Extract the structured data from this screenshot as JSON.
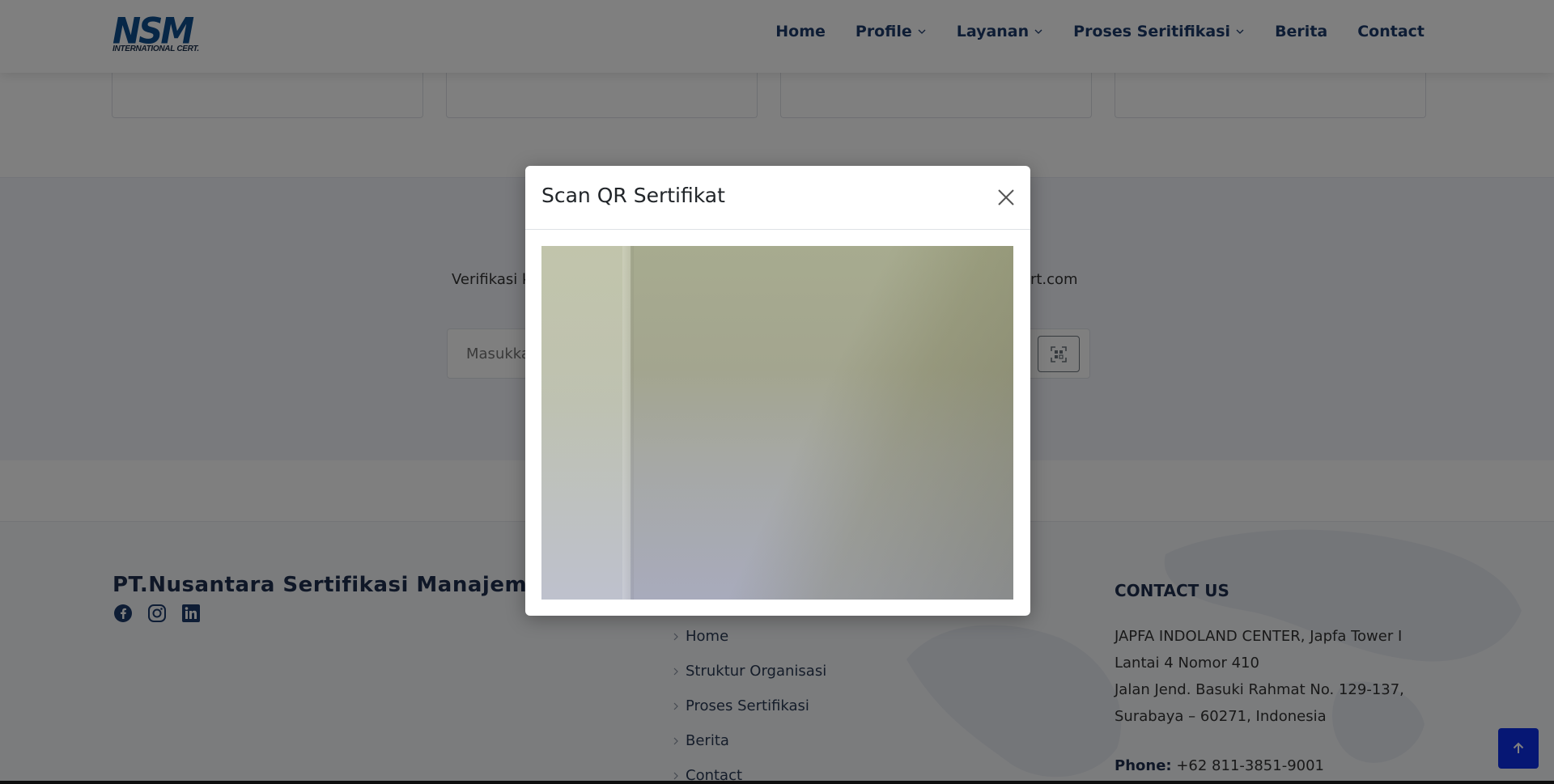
{
  "header": {
    "logo_text": "NSM",
    "logo_subtext": "INTERNATIONAL CERT.",
    "nav": [
      {
        "label": "Home",
        "dropdown": false
      },
      {
        "label": "Profile",
        "dropdown": true
      },
      {
        "label": "Layanan",
        "dropdown": true
      },
      {
        "label": "Proses Seritifikasi",
        "dropdown": true
      },
      {
        "label": "Berita",
        "dropdown": false
      },
      {
        "label": "Contact",
        "dropdown": false
      }
    ]
  },
  "verify": {
    "text_visible_start": "Verifikasi k",
    "text_visible_end": "cert.com",
    "search_placeholder_visible": "Masukka",
    "qr_button_icon": "qr-scan-icon"
  },
  "footer": {
    "company_name": "PT.Nusantara Sertifikasi Manajemen",
    "socials": [
      "facebook-icon",
      "instagram-icon",
      "linkedin-icon"
    ],
    "links": [
      "Home",
      "Struktur Organisasi",
      "Proses Sertifikasi",
      "Berita",
      "Contact"
    ],
    "contact_title": "CONTACT US",
    "address_line1": "JAPFA INDOLAND CENTER, Japfa Tower I Lantai 4 Nomor 410",
    "address_line2": "Jalan Jend. Basuki Rahmat No. 129-137, Surabaya – 60271, Indonesia",
    "phone_label": "Phone:",
    "phone_value": "+62 811-3851-9001"
  },
  "modal": {
    "title": "Scan QR Sertifikat",
    "close_icon": "close-icon",
    "video_feed": "camera-preview"
  },
  "back_to_top_icon": "arrow-up-icon",
  "colors": {
    "brand_navy": "#1d3a6b",
    "logo_blue": "#0f4f8f",
    "back_to_top": "#0d2ee8",
    "backdrop": "rgba(0,0,0,0.5)"
  }
}
